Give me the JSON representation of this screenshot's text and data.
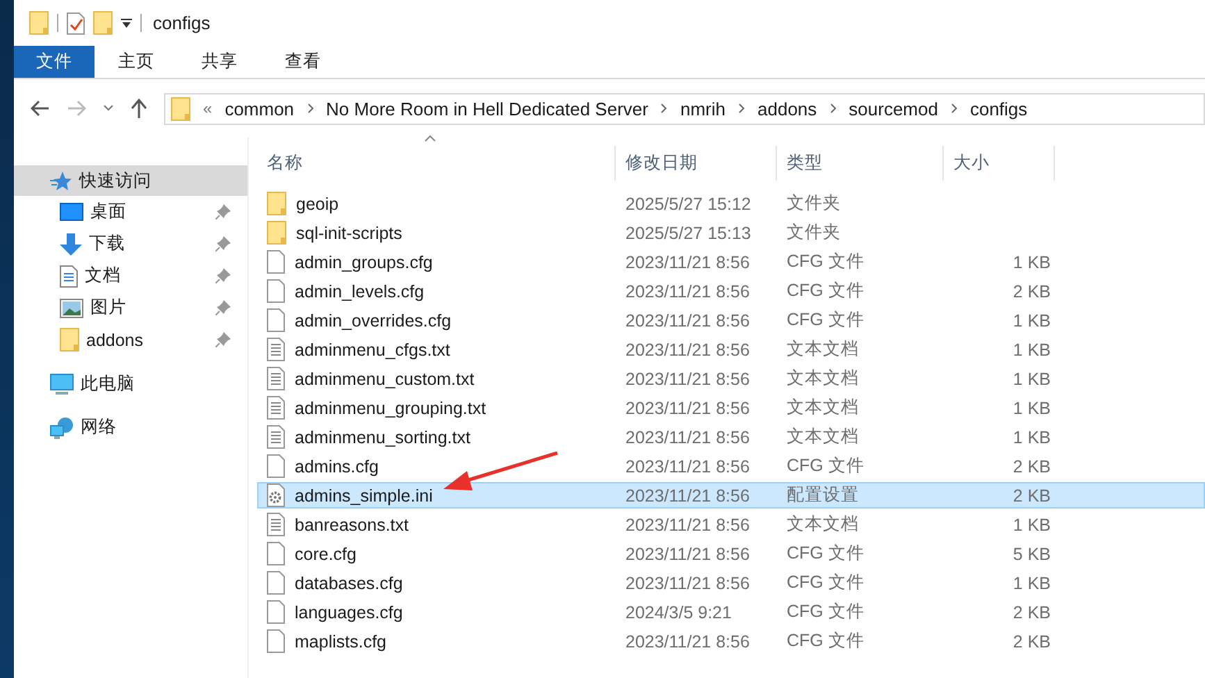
{
  "title_bar": {
    "title": "configs"
  },
  "ribbon_tabs": [
    {
      "label": "文件",
      "selected": true
    },
    {
      "label": "主页",
      "selected": false
    },
    {
      "label": "共享",
      "selected": false
    },
    {
      "label": "查看",
      "selected": false
    }
  ],
  "navigation": {
    "back_disabled": false,
    "forward_disabled": true
  },
  "address_bar": {
    "overflow": "«",
    "segments": [
      "common",
      "No More Room in Hell Dedicated Server",
      "nmrih",
      "addons",
      "sourcemod",
      "configs"
    ]
  },
  "sidebar": {
    "items": [
      {
        "label": "快速访问",
        "kind": "star",
        "selected": true,
        "children": [
          {
            "label": "桌面",
            "kind": "desktop",
            "selected": false,
            "pinned": true
          },
          {
            "label": "下载",
            "kind": "download",
            "selected": false,
            "pinned": true
          },
          {
            "label": "文档",
            "kind": "document",
            "selected": false,
            "pinned": true
          },
          {
            "label": "图片",
            "kind": "picture",
            "selected": false,
            "pinned": true
          },
          {
            "label": "addons",
            "kind": "folder",
            "selected": false,
            "pinned": true
          }
        ]
      },
      {
        "label": "此电脑",
        "kind": "pc",
        "selected": false
      },
      {
        "label": "网络",
        "kind": "network",
        "selected": false
      }
    ]
  },
  "table": {
    "columns": [
      "名称",
      "修改日期",
      "类型",
      "大小"
    ],
    "rows": [
      {
        "name": "geoip",
        "kind": "folder",
        "date": "2025/5/27 15:12",
        "type": "文件夹",
        "selected": false
      },
      {
        "name": "sql-init-scripts",
        "kind": "folder",
        "date": "2025/5/27 15:13",
        "type": "文件夹",
        "selected": false
      },
      {
        "name": "admin_groups.cfg",
        "kind": "blank",
        "date": "2023/11/21 8:56",
        "type": "CFG 文件",
        "size": "1 KB",
        "selected": false
      },
      {
        "name": "admin_levels.cfg",
        "kind": "blank",
        "date": "2023/11/21 8:56",
        "type": "CFG 文件",
        "size": "2 KB",
        "selected": false
      },
      {
        "name": "admin_overrides.cfg",
        "kind": "blank",
        "date": "2023/11/21 8:56",
        "type": "CFG 文件",
        "size": "1 KB",
        "selected": false
      },
      {
        "name": "adminmenu_cfgs.txt",
        "kind": "text",
        "date": "2023/11/21 8:56",
        "type": "文本文档",
        "size": "1 KB",
        "selected": false
      },
      {
        "name": "adminmenu_custom.txt",
        "kind": "text",
        "date": "2023/11/21 8:56",
        "type": "文本文档",
        "size": "1 KB",
        "selected": false
      },
      {
        "name": "adminmenu_grouping.txt",
        "kind": "text",
        "date": "2023/11/21 8:56",
        "type": "文本文档",
        "size": "1 KB",
        "selected": false
      },
      {
        "name": "adminmenu_sorting.txt",
        "kind": "text",
        "date": "2023/11/21 8:56",
        "type": "文本文档",
        "size": "1 KB",
        "selected": false
      },
      {
        "name": "admins.cfg",
        "kind": "blank",
        "date": "2023/11/21 8:56",
        "type": "CFG 文件",
        "size": "2 KB",
        "selected": false
      },
      {
        "name": "admins_simple.ini",
        "kind": "settings",
        "date": "2023/11/21 8:56",
        "type": "配置设置",
        "size": "2 KB",
        "selected": true
      },
      {
        "name": "banreasons.txt",
        "kind": "text",
        "date": "2023/11/21 8:56",
        "type": "文本文档",
        "size": "1 KB",
        "selected": false
      },
      {
        "name": "core.cfg",
        "kind": "blank",
        "date": "2023/11/21 8:56",
        "type": "CFG 文件",
        "size": "5 KB",
        "selected": false
      },
      {
        "name": "databases.cfg",
        "kind": "blank",
        "date": "2023/11/21 8:56",
        "type": "CFG 文件",
        "size": "1 KB",
        "selected": false
      },
      {
        "name": "languages.cfg",
        "kind": "blank",
        "date": "2024/3/5 9:21",
        "type": "CFG 文件",
        "size": "2 KB",
        "selected": false
      },
      {
        "name": "maplists.cfg",
        "kind": "blank",
        "date": "2023/11/21 8:56",
        "type": "CFG 文件",
        "size": "2 KB",
        "selected": false
      }
    ]
  }
}
